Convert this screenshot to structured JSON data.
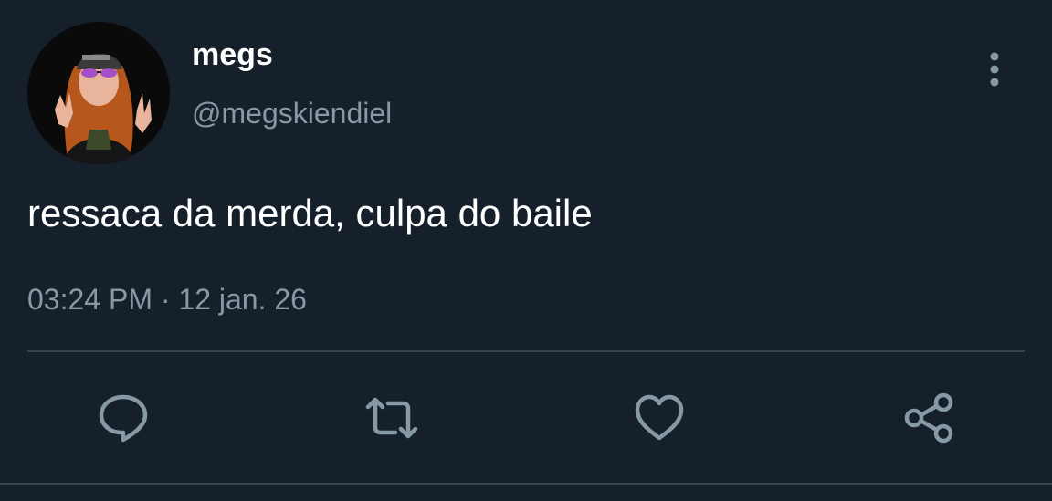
{
  "author": {
    "display_name": "megs",
    "handle": "@megskiendiel"
  },
  "tweet": {
    "text": "ressaca da merda, culpa do baile",
    "timestamp": "03:24 PM · 12 jan. 26"
  },
  "icons": {
    "more": "more-vertical-icon",
    "reply": "reply-icon",
    "retweet": "retweet-icon",
    "like": "heart-icon",
    "share": "share-icon"
  },
  "colors": {
    "background": "#15202b",
    "text_primary": "#ffffff",
    "text_secondary": "#8899a6",
    "divider": "#38444d",
    "icon": "#8899a6"
  }
}
